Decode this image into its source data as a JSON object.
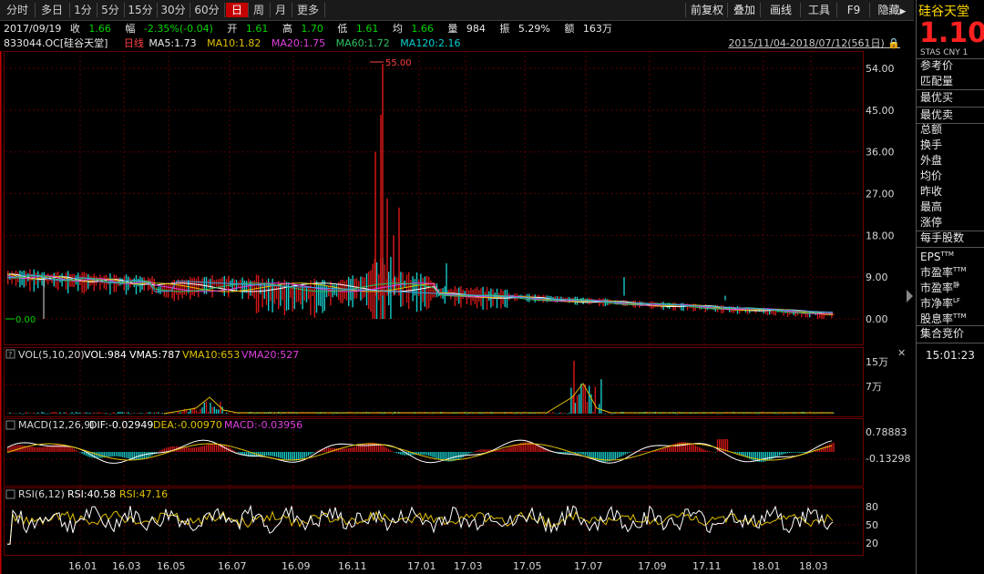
{
  "toolbar": {
    "tabs": [
      "分时",
      "多日",
      "1分",
      "5分",
      "15分",
      "30分",
      "60分",
      "日",
      "周",
      "月",
      "更多"
    ],
    "active": "日",
    "right_buttons": [
      "前复权",
      "叠加",
      "画线",
      "工具",
      "F9",
      "隐藏"
    ]
  },
  "info": {
    "date": "2017/09/19",
    "close_label": "收",
    "close": "1.66",
    "change_label": "幅",
    "change": "-2.35%(-0.04)",
    "open_label": "开",
    "open": "1.61",
    "high_label": "高",
    "high": "1.70",
    "low_label": "低",
    "low": "1.61",
    "avg_label": "均",
    "avg": "1.66",
    "vol_label": "量",
    "vol": "984",
    "amp_label": "振",
    "amp": "5.29%",
    "amount_label": "额",
    "amount": "163万"
  },
  "ma": {
    "code": "833044.OC",
    "name": "[硅谷天堂]",
    "kline": "日线",
    "ma5": "MA5:1.73",
    "ma10": "MA10:1.82",
    "ma20": "MA20:1.75",
    "ma60": "MA60:1.72",
    "ma120": "MA120:2.16",
    "range": "2015/11/04-2018/07/12(561日)"
  },
  "colors": {
    "up": "#e01818",
    "down": "#18d0d0",
    "ma5": "#ffffff",
    "ma10": "#e0c000",
    "ma20": "#e040e0",
    "ma60": "#30c060",
    "ma120": "#40a0e0"
  },
  "price_axis": [
    "54.00",
    "45.00",
    "36.00",
    "27.00",
    "18.00",
    "9.00",
    "0.00"
  ],
  "price_markers": {
    "high": "55.00",
    "low": "0.00"
  },
  "vol_panel": {
    "title": "VOL(5,10,20)",
    "vol": "VOL:984",
    "vma5": "VMA5:787",
    "vma10": "VMA10:653",
    "vma20": "VMA20:527",
    "axis": [
      "15万",
      "7万"
    ]
  },
  "macd_panel": {
    "title": "MACD(12,26,9)",
    "dif": "DIF:-0.02949",
    "dea": "DEA:-0.00970",
    "macd": "MACD:-0.03956",
    "axis": [
      "0.78883",
      "-0.13298"
    ]
  },
  "rsi_panel": {
    "title": "RSI(6,12)",
    "rsi1": "RSI:40.58",
    "rsi2": "RSI:47.16",
    "axis": [
      "80",
      "50",
      "20"
    ]
  },
  "dates": [
    "16.01",
    "16.03",
    "16.05",
    "16.07",
    "16.09",
    "16.11",
    "17.01",
    "17.03",
    "17.05",
    "17.07",
    "17.09",
    "17.11",
    "18.01",
    "18.03"
  ],
  "side": {
    "name": "硅谷天堂",
    "price": "1.10",
    "stats": "STAS  CNY  1",
    "items": [
      "参考价",
      "匹配量",
      "最优买",
      "最优卖",
      "总额",
      "换手",
      "外盘",
      "均价",
      "昨收",
      "最高",
      "涨停",
      "每手股数",
      "EPS",
      "市盈率",
      "市盈率",
      "市净率",
      "股息率",
      "集合竞价"
    ],
    "eps_sup": "TTM",
    "pe1_sup": "TTM",
    "pe2_sup": "静",
    "pb_sup": "LF",
    "dy_sup": "TTM",
    "clock": "15:01:23"
  }
}
